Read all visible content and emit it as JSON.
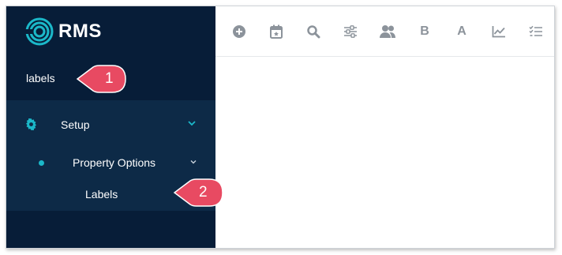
{
  "brand": {
    "name": "RMS"
  },
  "sidebar": {
    "search_value": "labels",
    "menu": {
      "setup_label": "Setup",
      "property_options_label": "Property Options",
      "labels_label": "Labels"
    }
  },
  "toolbar": {
    "icons": [
      "add-circle-icon",
      "calendar-icon",
      "search-icon",
      "sliders-icon",
      "users-icon",
      "bold-icon",
      "font-icon",
      "line-chart-icon",
      "checklist-icon"
    ],
    "bold_text": "B",
    "font_text": "A"
  },
  "callouts": [
    {
      "number": "1"
    },
    {
      "number": "2"
    }
  ],
  "colors": {
    "sidebar_bg": "#071d38",
    "menu_panel_bg": "#0d2a47",
    "accent": "#1bb8c9",
    "callout": "#e84a62",
    "toolbar_icon": "#8c939b"
  }
}
